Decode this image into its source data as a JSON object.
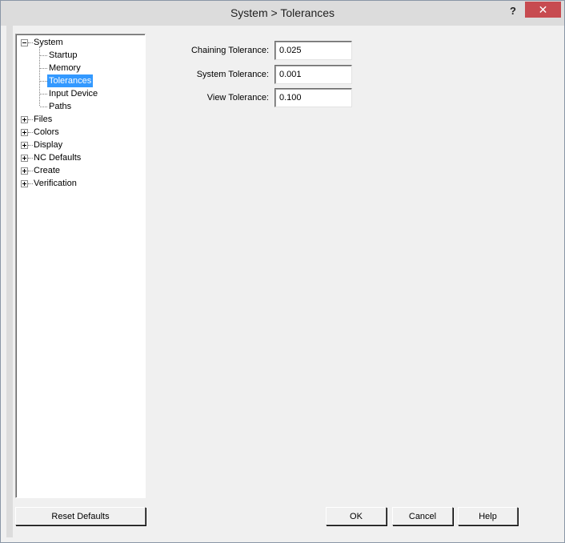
{
  "window": {
    "title": "System > Tolerances",
    "help_glyph": "?",
    "close_glyph": "✕"
  },
  "tree": {
    "items": [
      {
        "label": "System",
        "expanded": true
      },
      {
        "label": "Startup"
      },
      {
        "label": "Memory"
      },
      {
        "label": "Tolerances",
        "selected": true
      },
      {
        "label": "Input Device"
      },
      {
        "label": "Paths"
      },
      {
        "label": "Files",
        "expanded": false
      },
      {
        "label": "Colors",
        "expanded": false
      },
      {
        "label": "Display",
        "expanded": false
      },
      {
        "label": "NC Defaults",
        "expanded": false
      },
      {
        "label": "Create",
        "expanded": false
      },
      {
        "label": "Verification",
        "expanded": false
      }
    ]
  },
  "form": {
    "chaining_label": "Chaining Tolerance:",
    "chaining_value": "0.025",
    "system_label": "System Tolerance:",
    "system_value": "0.001",
    "view_label": "View Tolerance:",
    "view_value": "0.100"
  },
  "buttons": {
    "reset": "Reset Defaults",
    "ok": "OK",
    "cancel": "Cancel",
    "help": "Help"
  },
  "colors": {
    "selection": "#3399ff",
    "close_button": "#c74b50"
  }
}
